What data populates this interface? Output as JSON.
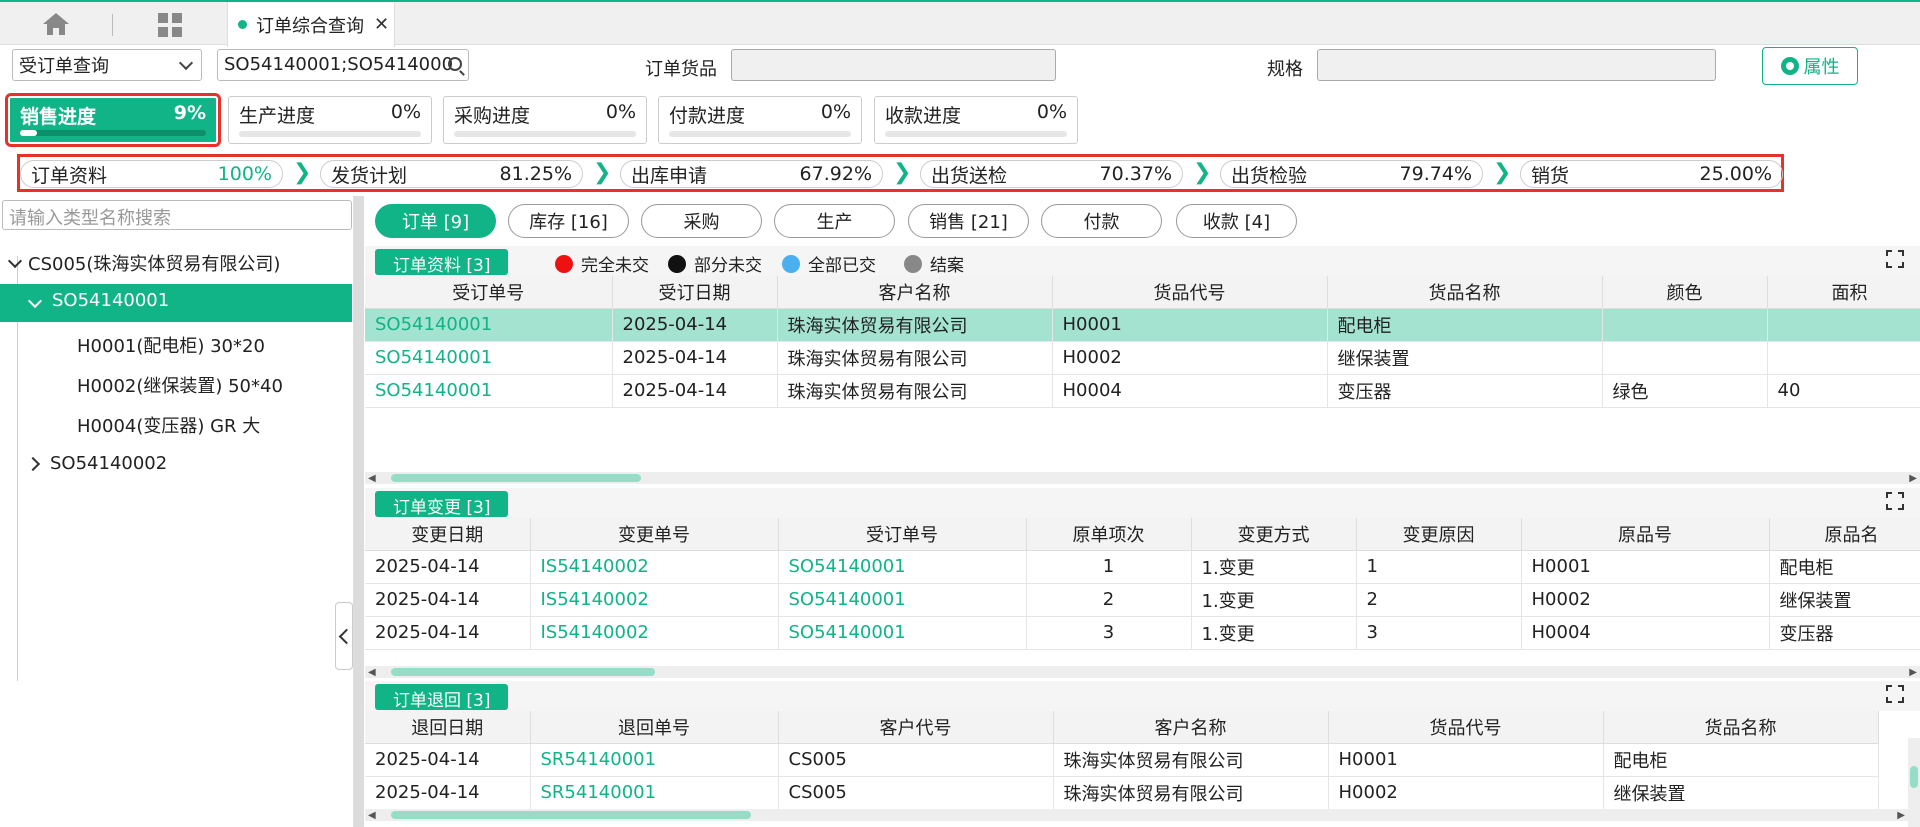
{
  "tab": {
    "label": "订单综合查询",
    "close": "✕"
  },
  "query": {
    "mode": "受订单查询",
    "search_value": "SO54140001;SO5414000",
    "goods_label": "订单货品",
    "goods_value": "",
    "spec_label": "规格",
    "spec_value": "",
    "props_label": "属性"
  },
  "progress": [
    {
      "label": "销售进度",
      "value": "9",
      "pct": "%",
      "fill": 0.09
    },
    {
      "label": "生产进度",
      "value": "0",
      "pct": "%",
      "fill": 0
    },
    {
      "label": "采购进度",
      "value": "0",
      "pct": "%",
      "fill": 0
    },
    {
      "label": "付款进度",
      "value": "0",
      "pct": "%",
      "fill": 0
    },
    {
      "label": "收款进度",
      "value": "0",
      "pct": "%",
      "fill": 0
    }
  ],
  "steps": [
    {
      "label": "订单资料",
      "value": "100%"
    },
    {
      "label": "发货计划",
      "value": "81.25%"
    },
    {
      "label": "出库申请",
      "value": "67.92%"
    },
    {
      "label": "出货送检",
      "value": "70.37%"
    },
    {
      "label": "出货检验",
      "value": "79.74%"
    },
    {
      "label": "销货",
      "value": "25.00%"
    }
  ],
  "step_arrow": "❯",
  "tree": {
    "search_placeholder": "请输入类型名称搜索",
    "root": "CS005(珠海实体贸易有限公司)",
    "selected": "SO54140001",
    "children": [
      "H0001(配电柜) 30*20",
      "H0002(继保装置) 50*40",
      "H0004(变压器) GR 大"
    ],
    "other": "SO54140002"
  },
  "buttons": [
    "订单 [9]",
    "库存 [16]",
    "采购",
    "生产",
    "销售 [21]",
    "付款",
    "收款 [4]"
  ],
  "legend": [
    {
      "label": "完全未交",
      "color": "#ee1111"
    },
    {
      "label": "部分未交",
      "color": "#111111"
    },
    {
      "label": "全部已交",
      "color": "#4ab0f0"
    },
    {
      "label": "结案",
      "color": "#888888"
    }
  ],
  "order": {
    "title": "订单资料 [3]",
    "headers": [
      "受订单号",
      "受订日期",
      "客户名称",
      "货品代号",
      "货品名称",
      "颜色",
      "面积"
    ],
    "rows": [
      [
        "SO54140001",
        "2025-04-14",
        "珠海实体贸易有限公司",
        "H0001",
        "配电柜",
        "",
        ""
      ],
      [
        "SO54140001",
        "2025-04-14",
        "珠海实体贸易有限公司",
        "H0002",
        "继保装置",
        "",
        ""
      ],
      [
        "SO54140001",
        "2025-04-14",
        "珠海实体贸易有限公司",
        "H0004",
        "变压器",
        "绿色",
        "40"
      ]
    ]
  },
  "change": {
    "title": "订单变更 [3]",
    "headers": [
      "变更日期",
      "变更单号",
      "受订单号",
      "原单项次",
      "变更方式",
      "变更原因",
      "原品号",
      "原品名"
    ],
    "rows": [
      [
        "2025-04-14",
        "IS54140002",
        "SO54140001",
        "1",
        "1.变更",
        "1",
        "H0001",
        "配电柜"
      ],
      [
        "2025-04-14",
        "IS54140002",
        "SO54140001",
        "2",
        "1.变更",
        "2",
        "H0002",
        "继保装置"
      ],
      [
        "2025-04-14",
        "IS54140002",
        "SO54140001",
        "3",
        "1.变更",
        "3",
        "H0004",
        "变压器"
      ]
    ]
  },
  "ret": {
    "title": "订单退回 [3]",
    "headers": [
      "退回日期",
      "退回单号",
      "客户代号",
      "客户名称",
      "货品代号",
      "货品名称"
    ],
    "rows": [
      [
        "2025-04-14",
        "SR54140001",
        "CS005",
        "珠海实体贸易有限公司",
        "H0001",
        "配电柜"
      ],
      [
        "2025-04-14",
        "SR54140001",
        "CS005",
        "珠海实体贸易有限公司",
        "H0002",
        "继保装置"
      ]
    ]
  },
  "colors": {
    "accent": "#10b487",
    "highlight": "#a4e3d0",
    "alert": "#e8312b"
  }
}
